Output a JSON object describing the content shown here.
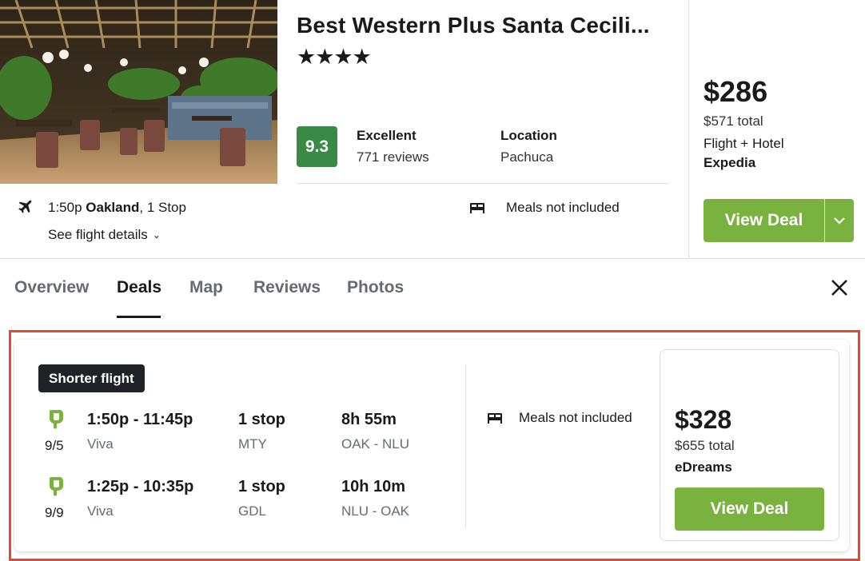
{
  "hotel": {
    "name": "Best Western Plus Santa Cecili...",
    "stars_text": "★★★★",
    "star_count": 4,
    "score": "9.3",
    "rating_word": "Excellent",
    "review_count": "771 reviews",
    "location_label": "Location",
    "location_value": "Pachuca",
    "photo_icon": "restaurant-photo"
  },
  "flight_summary": {
    "time": "1:50p",
    "origin": "Oakland",
    "stops": ", 1 Stop",
    "details_link": "See flight details",
    "meals": "Meals not included"
  },
  "top_price": {
    "price": "$286",
    "total": "$571 total",
    "package_type": "Flight + Hotel",
    "provider": "Expedia",
    "button_label": "View Deal"
  },
  "tabs": [
    {
      "label": "Overview",
      "active": false
    },
    {
      "label": "Deals",
      "active": true
    },
    {
      "label": "Map",
      "active": false
    },
    {
      "label": "Reviews",
      "active": false
    },
    {
      "label": "Photos",
      "active": false
    }
  ],
  "deal": {
    "badge": "Shorter flight",
    "legs": [
      {
        "date": "9/5",
        "times": "1:50p - 11:45p",
        "airline": "Viva",
        "stops": "1 stop",
        "via": "MTY",
        "duration": "8h 55m",
        "route": "OAK - NLU"
      },
      {
        "date": "9/9",
        "times": "1:25p - 10:35p",
        "airline": "Viva",
        "stops": "1 stop",
        "via": "GDL",
        "duration": "10h 10m",
        "route": "NLU - OAK"
      }
    ],
    "meals": "Meals not included",
    "price": "$328",
    "total": "$655 total",
    "provider": "eDreams",
    "button_label": "View Deal"
  },
  "colors": {
    "accent_green": "#7ab23f",
    "score_green": "#3a8a45",
    "airline_green": "#7ab23f",
    "highlight_red": "#e24a2e"
  }
}
